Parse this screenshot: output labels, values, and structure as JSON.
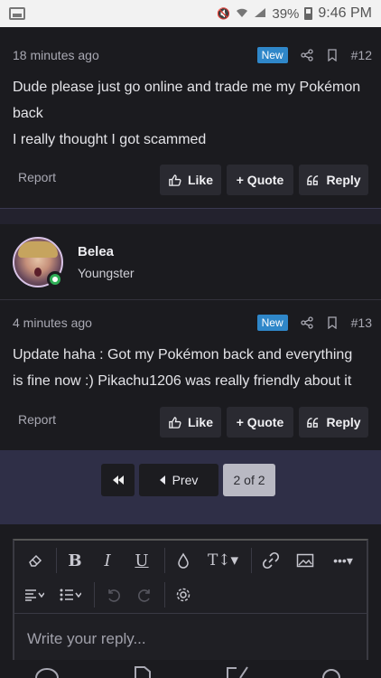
{
  "statusbar": {
    "battery": "39%",
    "time": "9:46 PM"
  },
  "posts": [
    {
      "time": "18 minutes ago",
      "badge": "New",
      "number": "#12",
      "lines": [
        "Dude please just go online and trade me my Pokémon",
        "back",
        "I really thought I got scammed"
      ]
    },
    {
      "time": "4 minutes ago",
      "badge": "New",
      "number": "#13",
      "lines": [
        "Update haha : Got my Pokémon back and everything",
        "is fine now :) Pikachu1206 was really friendly about it"
      ]
    }
  ],
  "actions": {
    "report": "Report",
    "like": "Like",
    "quote": "+ Quote",
    "reply": "Reply"
  },
  "user": {
    "name": "Belea",
    "title": "Youngster"
  },
  "pager": {
    "prev": "Prev",
    "current": "2 of 2"
  },
  "editor": {
    "placeholder": "Write your reply..."
  }
}
